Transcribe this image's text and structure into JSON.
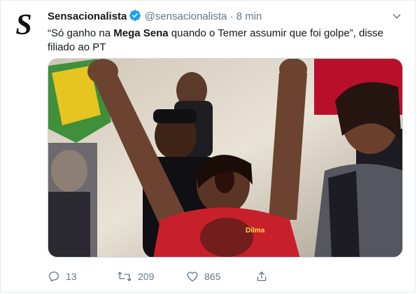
{
  "account": {
    "name": "Sensacionalista",
    "handle": "@sensacionalista",
    "separator": "·",
    "time": "8 min",
    "avatar_letter": "S"
  },
  "tweet": {
    "text_part1": "“Só ganho na ",
    "text_bold": "Mega Sena",
    "text_part2": " quando o Temer assumir que foi golpe”, disse filiado ao PT"
  },
  "photo": {
    "shirt_text": "Dilma"
  },
  "actions": {
    "reply_count": "13",
    "retweet_count": "209",
    "like_count": "865"
  },
  "icons": {
    "verified": "verified-badge-icon",
    "caret": "chevron-down-icon",
    "reply": "reply-icon",
    "retweet": "retweet-icon",
    "like": "heart-icon",
    "share": "share-icon"
  },
  "colors": {
    "verified_blue": "#1da1f2",
    "muted": "#657786",
    "text": "#14171a"
  }
}
